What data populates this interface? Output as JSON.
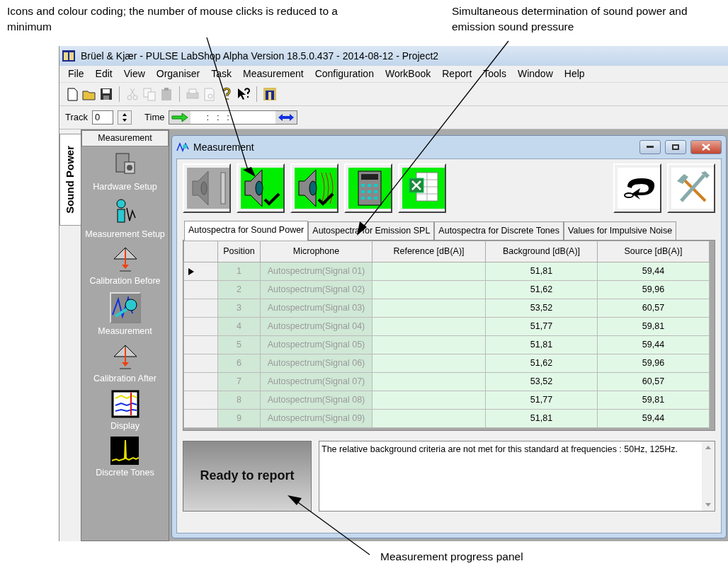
{
  "annotations": [
    {
      "kind": "top-left",
      "text": "Icons and colour coding; the number of mouse clicks is reduced to a minimum"
    },
    {
      "kind": "top-right",
      "text": "Simultaneous determination of sound power and emission sound pressure"
    },
    {
      "kind": "bottom",
      "text": "Measurement progress panel"
    }
  ],
  "window": {
    "title": "Brüel & Kjær - PULSE LabShop Alpha Version 18.5.0.437 - 2014-08-12 - Project2"
  },
  "menu": [
    "File",
    "Edit",
    "View",
    "Organiser",
    "Task",
    "Measurement",
    "Configuration",
    "WorkBook",
    "Report",
    "Tools",
    "Window",
    "Help"
  ],
  "toolbar": [
    {
      "kind": "new",
      "disabled": false
    },
    {
      "kind": "open",
      "disabled": false
    },
    {
      "kind": "save",
      "disabled": false
    },
    {
      "kind": "sep"
    },
    {
      "kind": "cut",
      "disabled": true
    },
    {
      "kind": "copy",
      "disabled": true
    },
    {
      "kind": "paste",
      "disabled": true
    },
    {
      "kind": "sep"
    },
    {
      "kind": "print",
      "disabled": true
    },
    {
      "kind": "preview",
      "disabled": true
    },
    {
      "kind": "help",
      "disabled": false
    },
    {
      "kind": "whatsthis",
      "disabled": false
    },
    {
      "kind": "sep"
    },
    {
      "kind": "app",
      "disabled": false
    }
  ],
  "track_bar": {
    "track_label": "Track",
    "track_value": "0",
    "time_label": "Time",
    "time_value": ":   :   :"
  },
  "side_tab": {
    "label": "Sound Power"
  },
  "sidebar": {
    "header": "Measurement",
    "items": [
      {
        "label": "Hardware Setup",
        "kind": "hardware",
        "selected": false
      },
      {
        "label": "Measurement Setup",
        "kind": "setup",
        "selected": false
      },
      {
        "label": "Calibration Before",
        "kind": "calibration",
        "selected": false
      },
      {
        "label": "Measurement",
        "kind": "measurement",
        "selected": true
      },
      {
        "label": "Calibration After",
        "kind": "calibration",
        "selected": false
      },
      {
        "label": "Display",
        "kind": "display",
        "selected": false
      },
      {
        "label": "Discrete Tones",
        "kind": "tones",
        "selected": false
      }
    ]
  },
  "child_window": {
    "title": "Measurement"
  },
  "action_buttons": [
    {
      "kind": "speaker-level",
      "done": false
    },
    {
      "kind": "speaker-check",
      "done": true
    },
    {
      "kind": "speaker-waves",
      "done": true
    },
    {
      "kind": "calculator",
      "done": true
    },
    {
      "kind": "excel",
      "done": true
    }
  ],
  "right_buttons": [
    {
      "kind": "undo"
    },
    {
      "kind": "tools"
    }
  ],
  "tabs": [
    {
      "label": "Autospectra for Sound Power",
      "selected": true
    },
    {
      "label": "Autospectra for Emission SPL",
      "selected": false
    },
    {
      "label": "Autospectra for Discrete Tones",
      "selected": false
    },
    {
      "label": "Values for Impulsive Noise",
      "selected": false
    }
  ],
  "table": {
    "columns": [
      "Position",
      "Microphone",
      "Reference [dB(A)]",
      "Background [dB(A)]",
      "Source [dB(A)]"
    ],
    "rows": [
      {
        "current": true,
        "cells": [
          "1",
          "Autospectrum(Signal 01)",
          "",
          "51,81",
          "59,44"
        ]
      },
      {
        "current": false,
        "cells": [
          "2",
          "Autospectrum(Signal 02)",
          "",
          "51,62",
          "59,96"
        ]
      },
      {
        "current": false,
        "cells": [
          "3",
          "Autospectrum(Signal 03)",
          "",
          "53,52",
          "60,57"
        ]
      },
      {
        "current": false,
        "cells": [
          "4",
          "Autospectrum(Signal 04)",
          "",
          "51,77",
          "59,81"
        ]
      },
      {
        "current": false,
        "cells": [
          "5",
          "Autospectrum(Signal 05)",
          "",
          "51,81",
          "59,44"
        ]
      },
      {
        "current": false,
        "cells": [
          "6",
          "Autospectrum(Signal 06)",
          "",
          "51,62",
          "59,96"
        ]
      },
      {
        "current": false,
        "cells": [
          "7",
          "Autospectrum(Signal 07)",
          "",
          "53,52",
          "60,57"
        ]
      },
      {
        "current": false,
        "cells": [
          "8",
          "Autospectrum(Signal 08)",
          "",
          "51,77",
          "59,81"
        ]
      },
      {
        "current": false,
        "cells": [
          "9",
          "Autospectrum(Signal 09)",
          "",
          "51,81",
          "59,44"
        ]
      }
    ]
  },
  "progress_panel": {
    "status": "Ready to report"
  },
  "message": "The relative background criteria are not met for this standard at frequencies : 50Hz, 125Hz."
}
